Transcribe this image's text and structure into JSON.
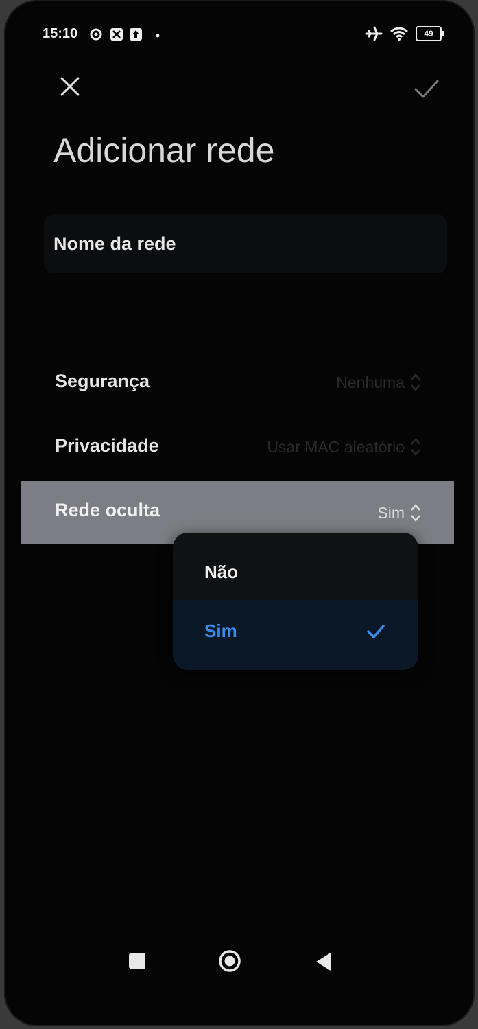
{
  "status_bar": {
    "time": "15:10",
    "battery": "49",
    "icons": [
      "settings-gear-icon",
      "app-notification-icon",
      "upload-notification-icon",
      "dot-icon",
      "airplane-icon",
      "wifi-icon",
      "battery-icon"
    ]
  },
  "header": {
    "title": "Adicionar rede",
    "close_icon": "close-icon",
    "confirm_icon": "check-icon"
  },
  "network_name": {
    "placeholder": "Nome da rede"
  },
  "settings": [
    {
      "label": "Segurança",
      "value": "Nenhuma"
    },
    {
      "label": "Privacidade",
      "value": "Usar MAC aleatório"
    },
    {
      "label": "Rede oculta",
      "value": "Sim"
    }
  ],
  "dropdown": {
    "options": [
      {
        "label": "Não",
        "selected": false
      },
      {
        "label": "Sim",
        "selected": true
      }
    ],
    "selected_color": "#3b8ce8"
  },
  "navigation": {
    "recent": "square-icon",
    "home": "circle-icon",
    "back": "triangle-back-icon"
  }
}
